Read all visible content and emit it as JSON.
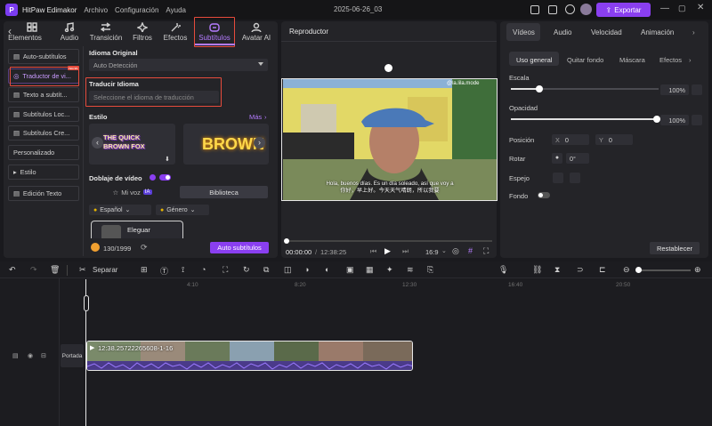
{
  "app": {
    "title": "HitPaw Edimakor",
    "menu": [
      "Archivo",
      "Configuración",
      "Ayuda"
    ],
    "project_name": "2025-06-26_03",
    "export_label": "Exportar"
  },
  "left_tabs": [
    {
      "label": "Elementos",
      "icon": "elements-icon"
    },
    {
      "label": "Audio",
      "icon": "music-icon"
    },
    {
      "label": "Transición",
      "icon": "transition-icon"
    },
    {
      "label": "Filtros",
      "icon": "filter-icon"
    },
    {
      "label": "Efectos",
      "icon": "effects-icon"
    },
    {
      "label": "Subtítulos",
      "icon": "subtitle-icon",
      "active": true
    },
    {
      "label": "Avatar AI",
      "icon": "avatar-icon"
    }
  ],
  "sidebar": {
    "items": [
      {
        "label": "Auto-subtítulos"
      },
      {
        "label": "Traductor de vi...",
        "badge": "NEW",
        "active": true
      },
      {
        "label": "Texto a subtít..."
      },
      {
        "label": "Subtítulos Loc..."
      },
      {
        "label": "Subtítulos Cre..."
      },
      {
        "label": "Personalizado"
      },
      {
        "label": "Estilo"
      },
      {
        "label": "Edición Texto"
      }
    ]
  },
  "translator": {
    "idioma_original_label": "Idioma Original",
    "idioma_original_value": "Auto Detección",
    "traducir_label": "Traducir Idioma",
    "traducir_placeholder": "Seleccione el idioma de traducción",
    "estilo_label": "Estilo",
    "mas_label": "Más",
    "style1_text": "THE QUICK BROWN FOX",
    "style2_text": "BROWN",
    "doblaje_label": "Doblaje de vídeo",
    "mi_voz_label": "Mi voz",
    "ia_badge": "IA",
    "biblioteca_label": "Biblioteca",
    "lang_option": "Español",
    "genero_option": "Género",
    "voice_name": "Eleguar",
    "credits": "130/1999",
    "auto_button": "Auto subtítulos"
  },
  "player": {
    "title": "Reproductor",
    "watermark": "@la.lila.mode",
    "subtitle_line1": "Hola, buenos días. Es un día soleado, así que voy a",
    "subtitle_line2": "你好，早上好。今天天气晴朗，所以我要",
    "current_time": "00:00:00",
    "total_time": "12:38:25",
    "aspect": "16:9"
  },
  "properties": {
    "tabs": [
      "Vídeos",
      "Audio",
      "Velocidad",
      "Animación"
    ],
    "subtabs": [
      "Uso general",
      "Quitar fondo",
      "Máscara",
      "Efectos"
    ],
    "escala_label": "Escala",
    "escala_value": "100%",
    "escala_percent": 100,
    "opacidad_label": "Opacidad",
    "opacidad_value": "100%",
    "opacidad_percent": 100,
    "posicion_label": "Posición",
    "pos_x_label": "X",
    "pos_x": "0",
    "pos_y_label": "Y",
    "pos_y": "0",
    "rotar_label": "Rotar",
    "rotar_value": "0°",
    "espejo_label": "Espejo",
    "fondo_label": "Fondo",
    "restablecer": "Restablecer"
  },
  "toolbar": {
    "separar_label": "Separar"
  },
  "timeline": {
    "ticks": [
      "4:10",
      "8:20",
      "12:30",
      "16:40",
      "20:50"
    ],
    "track_label": "Portada",
    "clip_label": "12:38.25722265608-1-16"
  },
  "colors": {
    "accent": "#8a3ff0",
    "highlight": "#e64b3c",
    "bg": "#1a1a1e",
    "panel": "#242428"
  }
}
